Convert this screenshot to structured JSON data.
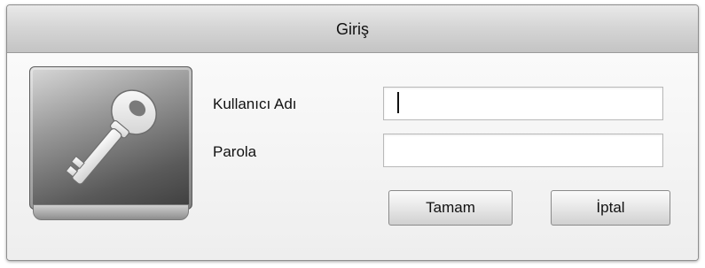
{
  "dialog": {
    "title": "Giriş",
    "icon": "key-icon",
    "username_label": "Kullanıcı Adı",
    "username_value": "",
    "password_label": "Parola",
    "password_value": "",
    "ok_label": "Tamam",
    "cancel_label": "İptal"
  },
  "colors": {
    "titlebar": "#d6d6d6",
    "background": "#f4f4f4",
    "border": "#8e8e8e"
  }
}
